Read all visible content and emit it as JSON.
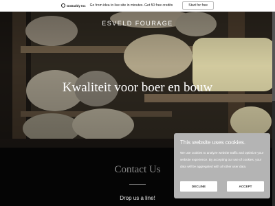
{
  "promo_bar": {
    "logo_text": "GoDaddy Inc",
    "message": "Go from idea to live site in minutes. Get 50 free credits",
    "cta_label": "Start for free"
  },
  "hero": {
    "brand": "ESVELD FOURAGE",
    "headline": "Kwaliteit voor boer en bouw"
  },
  "contact": {
    "title": "Contact Us",
    "subtitle": "Drop us a line!"
  },
  "cookie_banner": {
    "title": "This website uses cookies.",
    "text": "We use cookies to analyze website traffic and optimize your website experience. By accepting our use of cookies, your data will be aggregated with all other user data.",
    "decline_label": "DECLINE",
    "accept_label": "ACCEPT"
  },
  "colors": {
    "cookie_bg": "#b4b4b4",
    "contact_bg": "#050505"
  }
}
